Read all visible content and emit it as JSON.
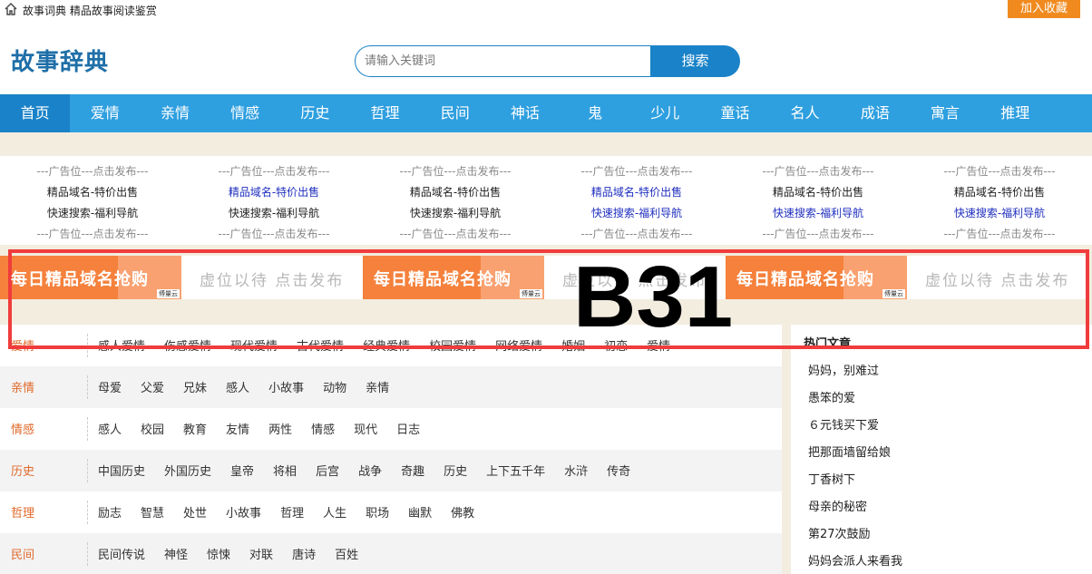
{
  "topbar": {
    "text": "故事词典 精品故事阅读鉴赏",
    "favorite_label": "加入收藏"
  },
  "header": {
    "logo": "故事辞典",
    "search_placeholder": "请输入关键词",
    "search_button": "搜索"
  },
  "nav": {
    "items": [
      "首页",
      "爱情",
      "亲情",
      "情感",
      "历史",
      "哲理",
      "民间",
      "神话",
      "鬼",
      "少儿",
      "童话",
      "名人",
      "成语",
      "寓言",
      "推理"
    ]
  },
  "ads": {
    "dash": "---广告位---点击发布---",
    "domain": "精品域名-特价出售",
    "search": "快速搜索-福利导航"
  },
  "banners": {
    "orange": "每日精品域名抢购",
    "white": "虚位以待 点击发布",
    "tag": "傅量云"
  },
  "categories": [
    {
      "name": "爱情",
      "links": [
        "感人爱情",
        "伤感爱情",
        "现代爱情",
        "古代爱情",
        "经典爱情",
        "校园爱情",
        "网络爱情",
        "婚姻",
        "初恋",
        "爱情"
      ]
    },
    {
      "name": "亲情",
      "links": [
        "母爱",
        "父爱",
        "兄妹",
        "感人",
        "小故事",
        "动物",
        "亲情"
      ]
    },
    {
      "name": "情感",
      "links": [
        "感人",
        "校园",
        "教育",
        "友情",
        "两性",
        "情感",
        "现代",
        "日志"
      ]
    },
    {
      "name": "历史",
      "links": [
        "中国历史",
        "外国历史",
        "皇帝",
        "将相",
        "后宫",
        "战争",
        "奇趣",
        "历史",
        "上下五千年",
        "水浒",
        "传奇"
      ]
    },
    {
      "name": "哲理",
      "links": [
        "励志",
        "智慧",
        "处世",
        "小故事",
        "哲理",
        "人生",
        "职场",
        "幽默",
        "佛教"
      ]
    },
    {
      "name": "民间",
      "links": [
        "民间传说",
        "神怪",
        "惊悚",
        "对联",
        "唐诗",
        "百姓"
      ]
    }
  ],
  "hot": {
    "title": "热门文章",
    "articles": [
      "妈妈，别难过",
      "愚笨的爱",
      "６元钱买下爱",
      "把那面墙留给娘",
      "丁香树下",
      "母亲的秘密",
      "第27次鼓励",
      "妈妈会派人来看我"
    ]
  },
  "overlay": {
    "label": "B31",
    "color": "#f03c3c"
  }
}
